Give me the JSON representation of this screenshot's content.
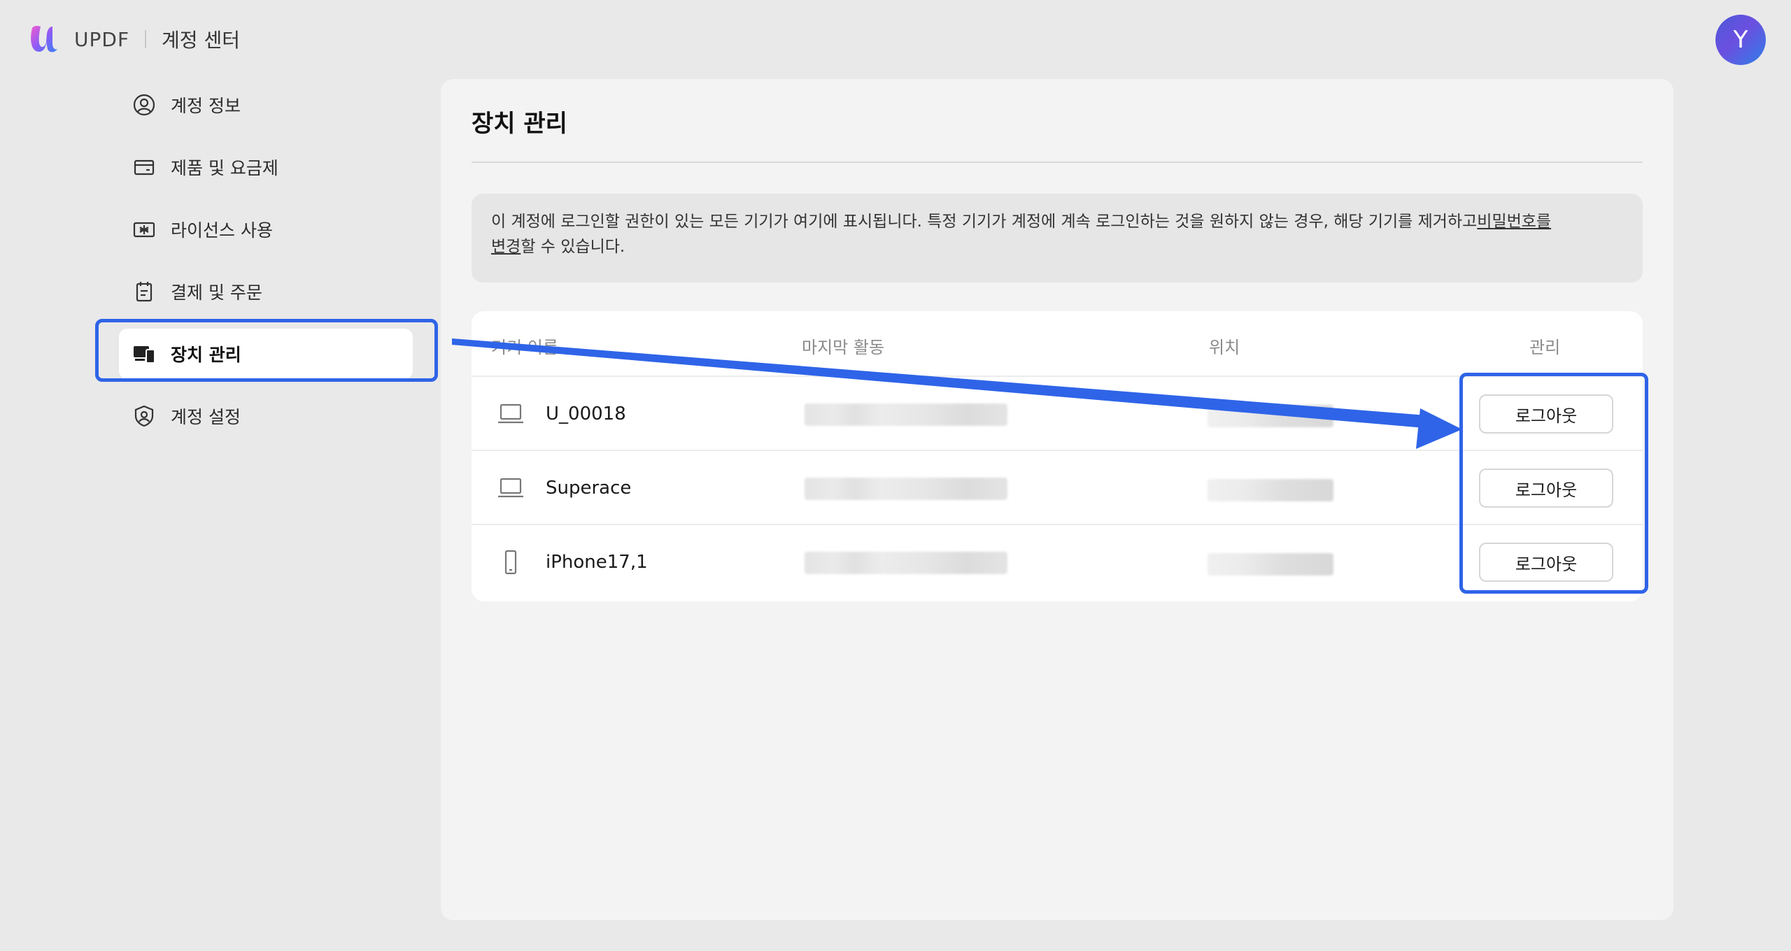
{
  "brand": {
    "name": "UPDF",
    "section": "계정 센터"
  },
  "user": {
    "avatar_initial": "Y"
  },
  "sidebar": {
    "items": [
      {
        "label": "계정 정보",
        "icon": "user-circle-icon",
        "active": false
      },
      {
        "label": "제품 및 요금제",
        "icon": "card-icon",
        "active": false
      },
      {
        "label": "라이선스 사용",
        "icon": "license-icon",
        "active": false
      },
      {
        "label": "결제 및 주문",
        "icon": "clipboard-icon",
        "active": false
      },
      {
        "label": "장치 관리",
        "icon": "devices-icon",
        "active": true
      },
      {
        "label": "계정 설정",
        "icon": "shield-user-icon",
        "active": false
      }
    ]
  },
  "main": {
    "title": "장치 관리",
    "notice": {
      "text": "이 계정에 로그인할 권한이 있는 모든 기기가 여기에 표시됩니다. 특정 기기가 계정에 계속 로그인하는 것을 원하지 않는 경우, 해당 기기를 제거하고",
      "link1": "비밀번호를",
      "link2": "변경",
      "suffix": "할 수 있습니다."
    },
    "table": {
      "headers": {
        "device": "기기 이름",
        "last_activity": "마지막 활동",
        "location": "위치",
        "manage": "관리"
      },
      "rows": [
        {
          "name": "U_00018",
          "type": "laptop",
          "action": "로그아웃"
        },
        {
          "name": "Superace",
          "type": "laptop",
          "action": "로그아웃"
        },
        {
          "name": "iPhone17,1",
          "type": "phone",
          "action": "로그아웃"
        }
      ]
    }
  },
  "colors": {
    "highlight": "#2f64e8",
    "background": "#e9e9e9",
    "panel": "#f3f3f3"
  }
}
